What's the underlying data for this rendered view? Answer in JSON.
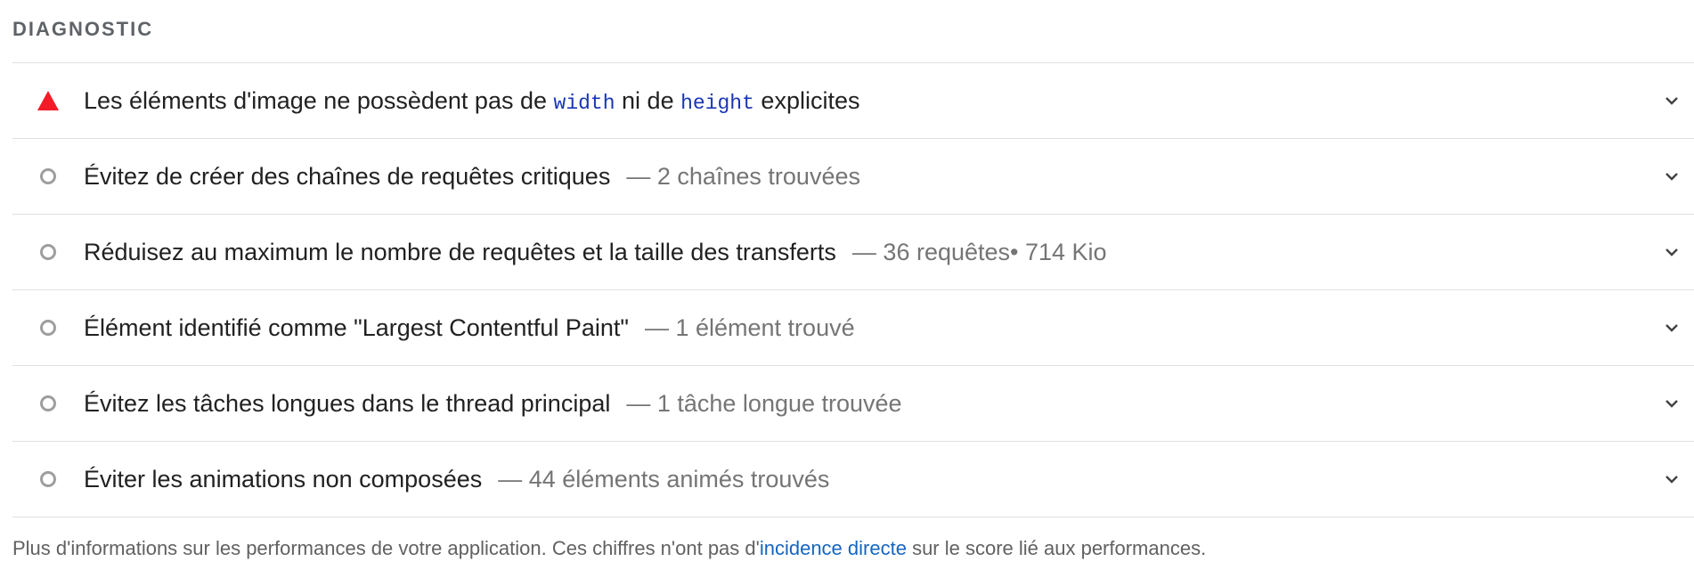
{
  "section": {
    "heading": "DIAGNOSTIC"
  },
  "audits": [
    {
      "status": "fail",
      "status_color": "#f21b27",
      "title_parts": [
        "Les éléments d'image ne possèdent pas de ",
        "width",
        " ni de ",
        "height",
        " explicites"
      ],
      "value": ""
    },
    {
      "status": "info",
      "title": "Évitez de créer des chaînes de requêtes critiques",
      "value": "— 2 chaînes trouvées"
    },
    {
      "status": "info",
      "title": "Réduisez au maximum le nombre de requêtes et la taille des transferts",
      "value": "— 36 requêtes• 714 Kio"
    },
    {
      "status": "info",
      "title": "Élément identifié comme \"Largest Contentful Paint\"",
      "value": "— 1 élément trouvé"
    },
    {
      "status": "info",
      "title": "Évitez les tâches longues dans le thread principal",
      "value": "— 1 tâche longue trouvée"
    },
    {
      "status": "info",
      "title": "Éviter les animations non composées",
      "value": "— 44 éléments animés trouvés"
    }
  ],
  "footer": {
    "before": "Plus d'informations sur les performances de votre application. Ces chiffres n'ont pas d'",
    "link_text": "incidence directe",
    "after": " sur le score lié aux performances."
  },
  "icons": {
    "fail": "triangle-warning-icon",
    "info": "circle-outline-icon",
    "expand": "chevron-down-icon"
  }
}
